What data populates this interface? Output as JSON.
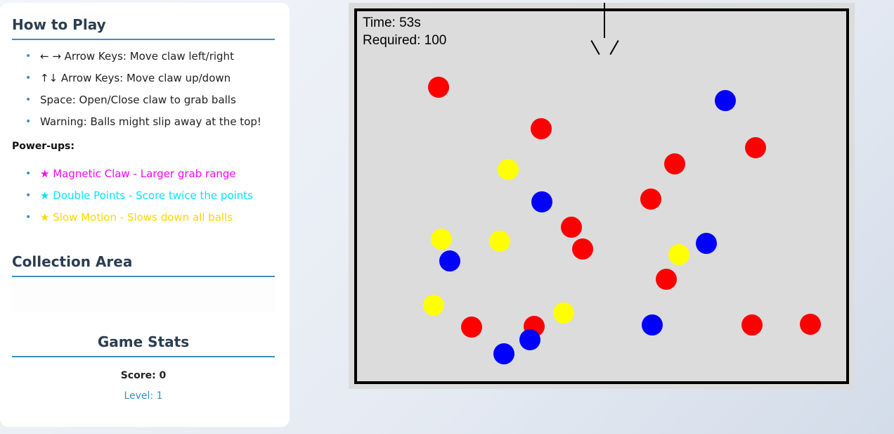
{
  "instructions": {
    "title": "How to Play",
    "rules": [
      "← → Arrow Keys: Move claw left/right",
      "↑↓ Arrow Keys: Move claw up/down",
      "Space: Open/Close claw to grab balls",
      "Warning: Balls might slip away at the top!"
    ],
    "powerups_label": "Power-ups:",
    "powerups": [
      {
        "label": "★ Magnetic Claw - Larger grab range",
        "color": "#ff00ff"
      },
      {
        "label": "★ Double Points - Score twice the points",
        "color": "#00e5ff"
      },
      {
        "label": "★ Slow Motion - Slows down all balls",
        "color": "#ffd700"
      }
    ]
  },
  "collection": {
    "title": "Collection Area"
  },
  "stats": {
    "title": "Game Stats",
    "score": "Score: 0",
    "level": "Level: 1"
  },
  "game": {
    "time": "Time: 53s",
    "required": "Required: 100",
    "colors": {
      "red": "#ff0000",
      "blue": "#0000ff",
      "yellow": "#ffff00",
      "board": "#dcdcdc"
    }
  }
}
